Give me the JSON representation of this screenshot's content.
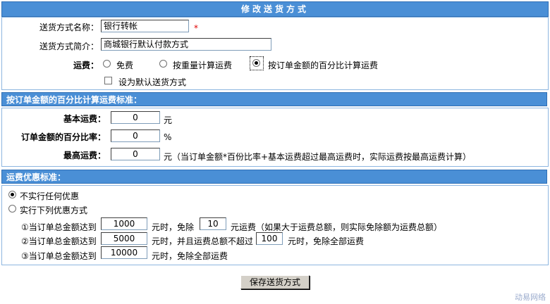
{
  "title": "修改送货方式",
  "form": {
    "name_label": "送货方式名称：",
    "name_value": "银行转帐",
    "required_mark": "*",
    "desc_label": "送货方式简介：",
    "desc_value": "商城银行默认付款方式",
    "fee_label": "运费：",
    "fee_options": [
      "免费",
      "按重量计算运费",
      "按订单金额的百分比计算运费"
    ],
    "fee_selected": 2,
    "default_label": "设为默认送货方式",
    "default_checked": false
  },
  "percent_section": {
    "header": "按订单金额的百分比计算运费标准：",
    "base_label": "基本运费：",
    "base_value": "0",
    "base_unit": "元",
    "rate_label": "订单金额的百分比率：",
    "rate_value": "0",
    "rate_unit": "%",
    "max_label": "最高运费：",
    "max_value": "0",
    "max_note": "元（当订单金额*百份比率+基本运费超过最高运费时，实际运费按最高运费计算）"
  },
  "discount_section": {
    "header": "运费优惠标准：",
    "option_none": "不实行任何优惠",
    "option_below": "实行下列优惠方式",
    "selected": 0,
    "rule1_prefix": "①当订单总金额达到",
    "rule1_amount": "1000",
    "rule1_mid": "元时，免除",
    "rule1_fee": "10",
    "rule1_suffix": "元运费（如果大于运费总额，则实际免除额为运费总额）",
    "rule2_prefix": "②当订单总金额达到",
    "rule2_amount": "5000",
    "rule2_mid": "元时，并且运费总额不超过",
    "rule2_fee": "100",
    "rule2_suffix": "元时，免除全部运费",
    "rule3_prefix": "③当订单总金额达到",
    "rule3_amount": "10000",
    "rule3_suffix": "元时，免除全部运费"
  },
  "save_button": "保存送货方式",
  "watermark": "动易网络"
}
